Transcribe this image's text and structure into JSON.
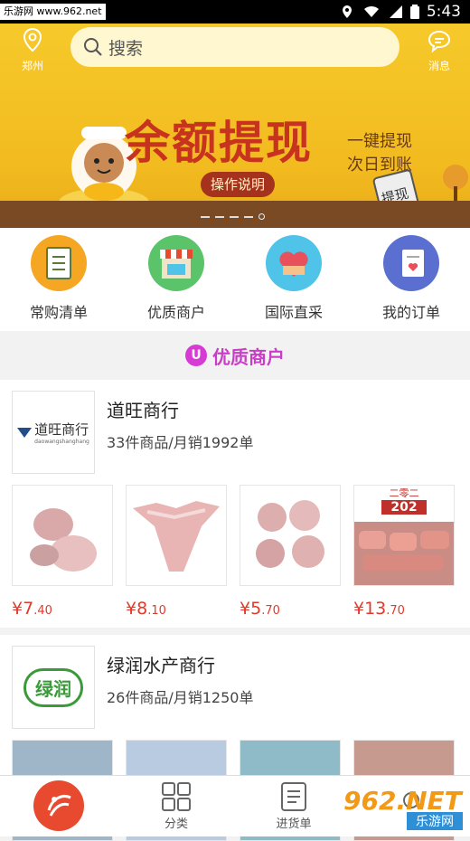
{
  "status_bar": {
    "source_label": "乐游网 www.962.net",
    "time": "5:43"
  },
  "header": {
    "location_label": "郑州",
    "search_placeholder": "搜索",
    "message_label": "消息"
  },
  "banner": {
    "title": "余额提现",
    "subtitle": "一键提现 次日到账",
    "button_label": "操作说明",
    "tag": "提现",
    "slide_count": 5,
    "active_slide": 5
  },
  "quick_links": [
    {
      "label": "常购清单",
      "icon": "checklist-icon",
      "color": "#f5a623"
    },
    {
      "label": "优质商户",
      "icon": "storefront-icon",
      "color": "#5bc36a"
    },
    {
      "label": "国际直采",
      "icon": "heart-box-icon",
      "color": "#4fc3e8"
    },
    {
      "label": "我的订单",
      "icon": "order-heart-icon",
      "color": "#5b6fd1"
    }
  ],
  "section": {
    "logo_glyph": "U",
    "title": "优质商户"
  },
  "merchants": [
    {
      "name": "道旺商行",
      "stats": "33件商品/月销1992单",
      "logo_text": "道旺商行",
      "logo_sub": "daowangshanghang",
      "products": [
        {
          "price_int": "¥7",
          "price_dec": ".40"
        },
        {
          "price_int": "¥8",
          "price_dec": ".10"
        },
        {
          "price_int": "¥5",
          "price_dec": ".70"
        },
        {
          "price_int": "¥13",
          "price_dec": ".70",
          "tag_top": "二零二",
          "tag_num": "202"
        }
      ]
    },
    {
      "name": "绿润水产商行",
      "stats": "26件商品/月销1250单",
      "logo_text": "绿润"
    }
  ],
  "tabbar": {
    "tabs": [
      {
        "label": ""
      },
      {
        "label": "分类"
      },
      {
        "label": "进货单"
      },
      {
        "label": ""
      }
    ]
  },
  "watermark": {
    "top": "962.NET",
    "bottom": "乐游网"
  },
  "colors": {
    "accent_pink": "#c93ec6",
    "price_red": "#e03a2c",
    "banner_yellow": "#f6c92a"
  }
}
